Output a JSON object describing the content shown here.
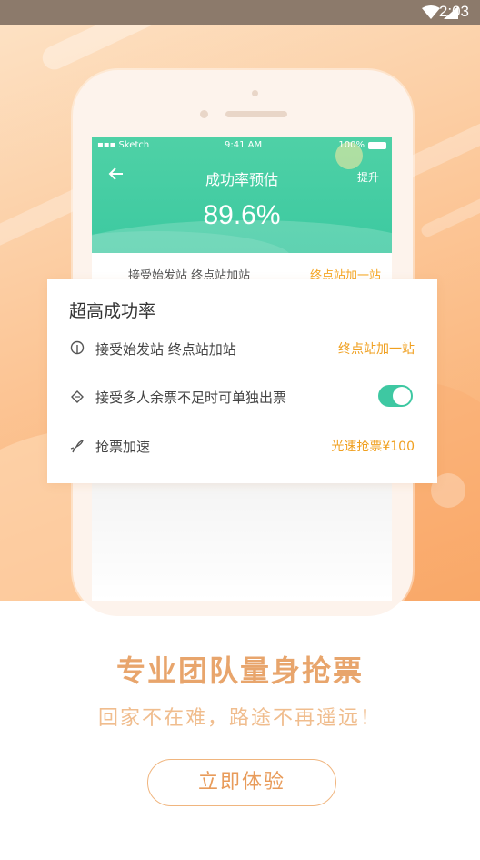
{
  "system": {
    "time": "2:03",
    "icons": [
      "wifi-icon",
      "signal-icon"
    ]
  },
  "mock_screen": {
    "status": {
      "carrier": "Sketch",
      "time": "9:41 AM",
      "battery": "100%"
    },
    "title": "成功率预估",
    "action": "提升",
    "rate": "89.6%",
    "partial_row": {
      "label": "接受始发站 终点站加站",
      "value": "终点站加一站"
    }
  },
  "card": {
    "title": "超高成功率",
    "rows": [
      {
        "icon": "pin-icon",
        "label": "接受始发站 终点站加站",
        "value": "终点站加一站"
      },
      {
        "icon": "ticket-icon",
        "label": "接受多人余票不足时可单独出票",
        "toggle_on": true
      },
      {
        "icon": "rocket-icon",
        "label": "抢票加速",
        "value": "光速抢票¥100"
      }
    ]
  },
  "headline": "专业团队量身抢票",
  "subline": "回家不在难，路途不再遥远！",
  "cta_label": "立即体验",
  "colors": {
    "accent": "#3ec8a2",
    "orange_text": "#f0a020",
    "headline": "#e8a56c"
  }
}
